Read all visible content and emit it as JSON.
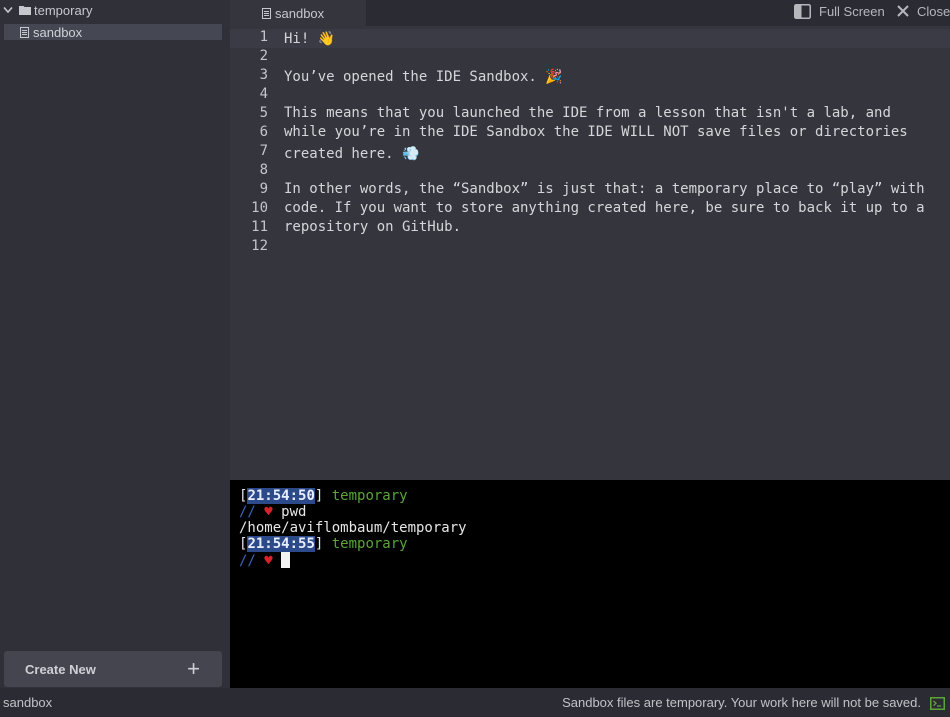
{
  "sidebar": {
    "root_folder": "temporary",
    "file": "sandbox",
    "create_new_label": "Create New",
    "create_new_plus": "+"
  },
  "tabbar": {
    "active_tab": "sandbox",
    "fullscreen_label": "Full Screen",
    "close_label": "Close"
  },
  "editor": {
    "lines": [
      {
        "n": "1",
        "text": "Hi! 👋"
      },
      {
        "n": "2",
        "text": ""
      },
      {
        "n": "3",
        "text": "You’ve opened the IDE Sandbox. 🎉"
      },
      {
        "n": "4",
        "text": ""
      },
      {
        "n": "5",
        "text": "This means that you launched the IDE from a lesson that isn't a lab, and"
      },
      {
        "n": "6",
        "text": "while you’re in the IDE Sandbox the IDE WILL NOT save files or directories"
      },
      {
        "n": "7",
        "text": "created here. 💨"
      },
      {
        "n": "8",
        "text": ""
      },
      {
        "n": "9",
        "text": "In other words, the “Sandbox” is just that: a temporary place to “play” with"
      },
      {
        "n": "10",
        "text": "code. If you want to store anything created here, be sure to back it up to a"
      },
      {
        "n": "11",
        "text": "repository on GitHub."
      },
      {
        "n": "12",
        "text": ""
      }
    ]
  },
  "terminal": {
    "prompt1_time": "21:54:50",
    "prompt1_dir": "temporary",
    "command1": "pwd",
    "output1": "/home/aviflombaum/temporary",
    "prompt2_time": "21:54:55",
    "prompt2_dir": "temporary",
    "slashes": "//",
    "heart": "♥"
  },
  "statusbar": {
    "left_label": "sandbox",
    "message": "Sandbox files are temporary. Your work here will not be saved."
  },
  "colors": {
    "sidebar_bg": "#2f3038",
    "editor_bg": "#34353d",
    "terminal_bg": "#000000",
    "time_highlight": "#2c4a8a",
    "dir_green": "#5aa43b",
    "heart_red": "#d8232a",
    "slash_blue": "#3c63b8"
  }
}
